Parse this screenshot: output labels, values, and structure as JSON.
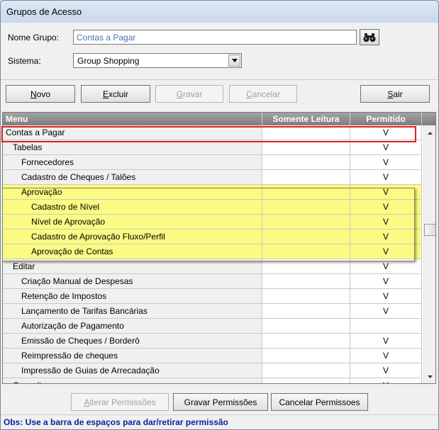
{
  "window": {
    "title": "Grupos de Acesso"
  },
  "form": {
    "nome_grupo_label": "Nome Grupo:",
    "nome_grupo_value": "Contas a Pagar",
    "sistema_label": "Sistema:",
    "sistema_value": "Group Shopping"
  },
  "toolbar": {
    "novo": {
      "key": "N",
      "rest": "ovo"
    },
    "excluir": {
      "key": "E",
      "rest": "xcluir"
    },
    "gravar": {
      "key": "G",
      "rest": "ravar"
    },
    "cancelar": {
      "key": "C",
      "rest": "ancelar"
    },
    "sair": {
      "key": "S",
      "rest": "air"
    }
  },
  "grid": {
    "columns": [
      "Menu",
      "Somente Leitura",
      "Permitido"
    ],
    "rows": [
      {
        "menu": "Contas a Pagar",
        "somente_leitura": "",
        "permitido": "V",
        "indent": 0,
        "highlight": false
      },
      {
        "menu": "Tabelas",
        "somente_leitura": "",
        "permitido": "V",
        "indent": 1,
        "highlight": false
      },
      {
        "menu": "Fornecedores",
        "somente_leitura": "",
        "permitido": "V",
        "indent": 2,
        "highlight": false
      },
      {
        "menu": "Cadastro de Cheques / Talões",
        "somente_leitura": "",
        "permitido": "V",
        "indent": 2,
        "highlight": false
      },
      {
        "menu": "Aprovação",
        "somente_leitura": "",
        "permitido": "V",
        "indent": 2,
        "highlight": true
      },
      {
        "menu": "Cadastro de Nível",
        "somente_leitura": "",
        "permitido": "V",
        "indent": 3,
        "highlight": true
      },
      {
        "menu": "Nível de Aprovação",
        "somente_leitura": "",
        "permitido": "V",
        "indent": 3,
        "highlight": true
      },
      {
        "menu": "Cadastro de Aprovação Fluxo/Perfil",
        "somente_leitura": "",
        "permitido": "V",
        "indent": 3,
        "highlight": true
      },
      {
        "menu": "Aprovação de Contas",
        "somente_leitura": "",
        "permitido": "V",
        "indent": 3,
        "highlight": true
      },
      {
        "menu": "Editar",
        "somente_leitura": "",
        "permitido": "V",
        "indent": 1,
        "highlight": false
      },
      {
        "menu": "Criação Manual de Despesas",
        "somente_leitura": "",
        "permitido": "V",
        "indent": 2,
        "highlight": false
      },
      {
        "menu": "Retenção de Impostos",
        "somente_leitura": "",
        "permitido": "V",
        "indent": 2,
        "highlight": false
      },
      {
        "menu": "Lançamento de Tarifas Bancárias",
        "somente_leitura": "",
        "permitido": "V",
        "indent": 2,
        "highlight": false
      },
      {
        "menu": "Autorização de Pagamento",
        "somente_leitura": "",
        "permitido": "",
        "indent": 2,
        "highlight": false
      },
      {
        "menu": "Emissão de Cheques / Borderô",
        "somente_leitura": "",
        "permitido": "V",
        "indent": 2,
        "highlight": false
      },
      {
        "menu": "Reimpressão de cheques",
        "somente_leitura": "",
        "permitido": "V",
        "indent": 2,
        "highlight": false
      },
      {
        "menu": "Impressão de Guias de Arrecadação",
        "somente_leitura": "",
        "permitido": "V",
        "indent": 2,
        "highlight": false
      },
      {
        "menu": "Consultas",
        "somente_leitura": "",
        "permitido": "V",
        "indent": 1,
        "highlight": false
      }
    ]
  },
  "bottom": {
    "alterar": {
      "key": "A",
      "rest": "lterar Permissões"
    },
    "gravar": "Gravar Permissões",
    "cancelar": "Cancelar Permissoes"
  },
  "obs": "Obs: Use a barra de espaços para dar/retirar permissão",
  "icons": {
    "search": "binoculars-icon",
    "dropdown": "triangle-down-icon",
    "scroll_up": "triangle-up-icon",
    "scroll_down": "triangle-down-icon"
  },
  "colors": {
    "highlight": "#fbfb84",
    "selection_border": "#e02020",
    "obs_text": "#0a1f9a",
    "header_bg": "#8c8c8c"
  }
}
